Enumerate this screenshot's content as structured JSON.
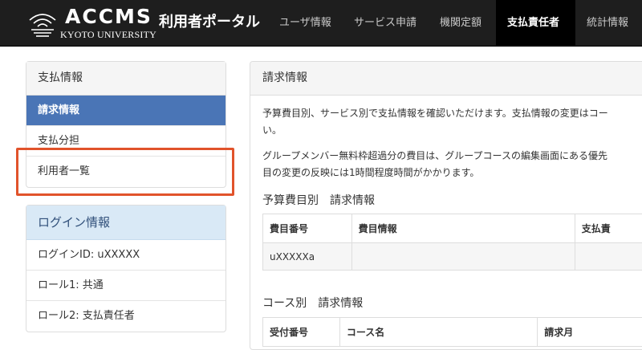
{
  "header": {
    "logo_name": "ACCMS",
    "logo_sub": "KYOTO UNIVERSITY",
    "brand": "利用者ポータル",
    "nav": [
      {
        "label": "ユーザ情報"
      },
      {
        "label": "サービス申請"
      },
      {
        "label": "機関定額"
      },
      {
        "label": "支払責任者",
        "active": true
      },
      {
        "label": "統計情報"
      }
    ]
  },
  "sidebar": {
    "payment": {
      "title": "支払情報",
      "items": [
        {
          "label": "請求情報",
          "active": true
        },
        {
          "label": "支払分担"
        },
        {
          "label": "利用者一覧",
          "highlighted": true
        }
      ]
    },
    "login": {
      "title": "ログイン情報",
      "items": [
        {
          "label": "ログインID: uXXXXX"
        },
        {
          "label": "ロール1: 共通"
        },
        {
          "label": "ロール2: 支払責任者"
        }
      ]
    }
  },
  "main": {
    "title": "請求情報",
    "paragraph1_line1": "予算費目別、サービス別で支払情報を確認いただけます。支払情報の変更はコー",
    "paragraph1_line2": "い。",
    "paragraph2_line1": "グループメンバー無料枠超過分の費目は、グループコースの編集画面にある優先",
    "paragraph2_line2": "目の変更の反映には1時間程度時間がかかります。",
    "budget_section": {
      "title": "予算費目別　請求情報",
      "columns": [
        "費目番号",
        "費目情報",
        "支払責"
      ],
      "rows": [
        [
          "uXXXXXa",
          "",
          ""
        ]
      ]
    },
    "course_section": {
      "title": "コース別　請求情報",
      "columns": [
        "受付番号",
        "コース名",
        "請求月"
      ]
    }
  },
  "colors": {
    "navbar_bg": "#1e1e1e",
    "active_item": "#4a75b6",
    "login_header": "#d9e9f6",
    "callout": "#e1532b"
  }
}
